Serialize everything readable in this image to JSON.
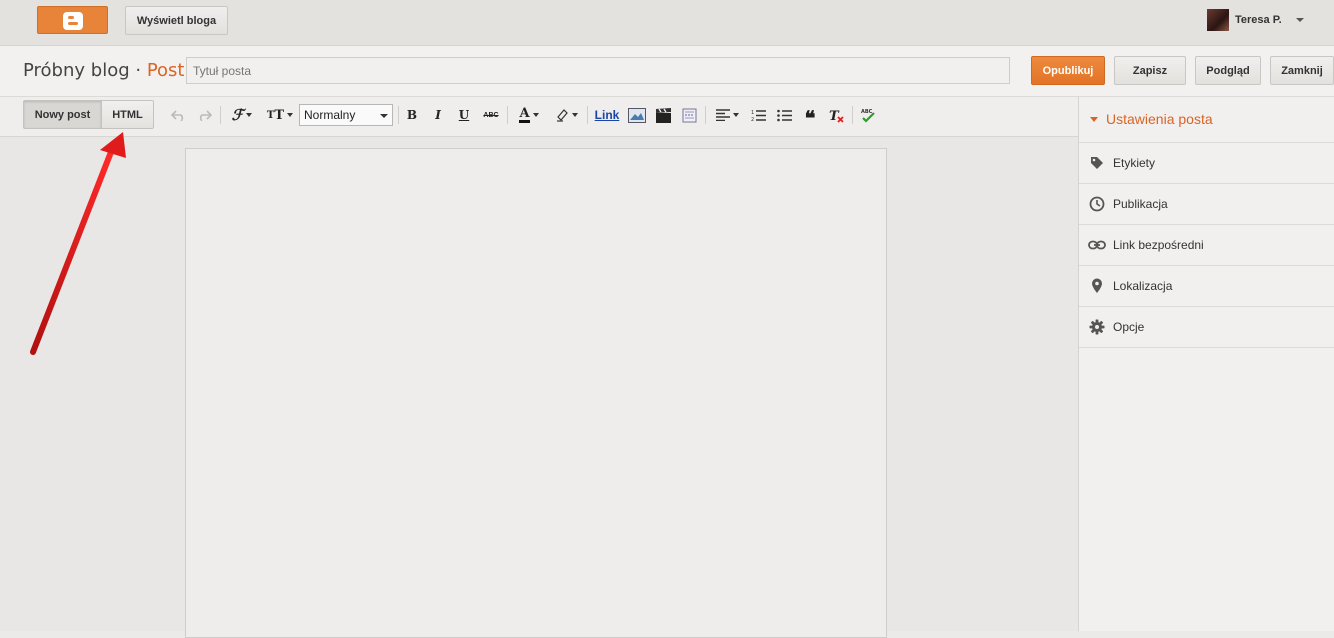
{
  "topbar": {
    "view_blog_label": "Wyświetl bloga",
    "user_name": "Teresa P."
  },
  "header": {
    "blog_name": "Próbny blog",
    "separator": " · ",
    "section": "Post",
    "title_placeholder": "Tytuł posta",
    "buttons": {
      "publish": "Opublikuj",
      "save": "Zapisz",
      "preview": "Podgląd",
      "close": "Zamknij"
    }
  },
  "toolbar": {
    "mode_compose": "Nowy post",
    "mode_html": "HTML",
    "format_select": "Normalny",
    "link_label": "Link",
    "bold": "B",
    "italic": "I",
    "underline": "U",
    "strike": "ABC"
  },
  "sidebar": {
    "heading": "Ustawienia posta",
    "items": [
      {
        "label": "Etykiety",
        "icon": "tag-icon"
      },
      {
        "label": "Publikacja",
        "icon": "clock-icon"
      },
      {
        "label": "Link bezpośredni",
        "icon": "link-icon"
      },
      {
        "label": "Lokalizacja",
        "icon": "location-pin-icon"
      },
      {
        "label": "Opcje",
        "icon": "gear-icon"
      }
    ]
  },
  "colors": {
    "accent": "#e37326",
    "annotation_arrow": "#e01b1b"
  }
}
